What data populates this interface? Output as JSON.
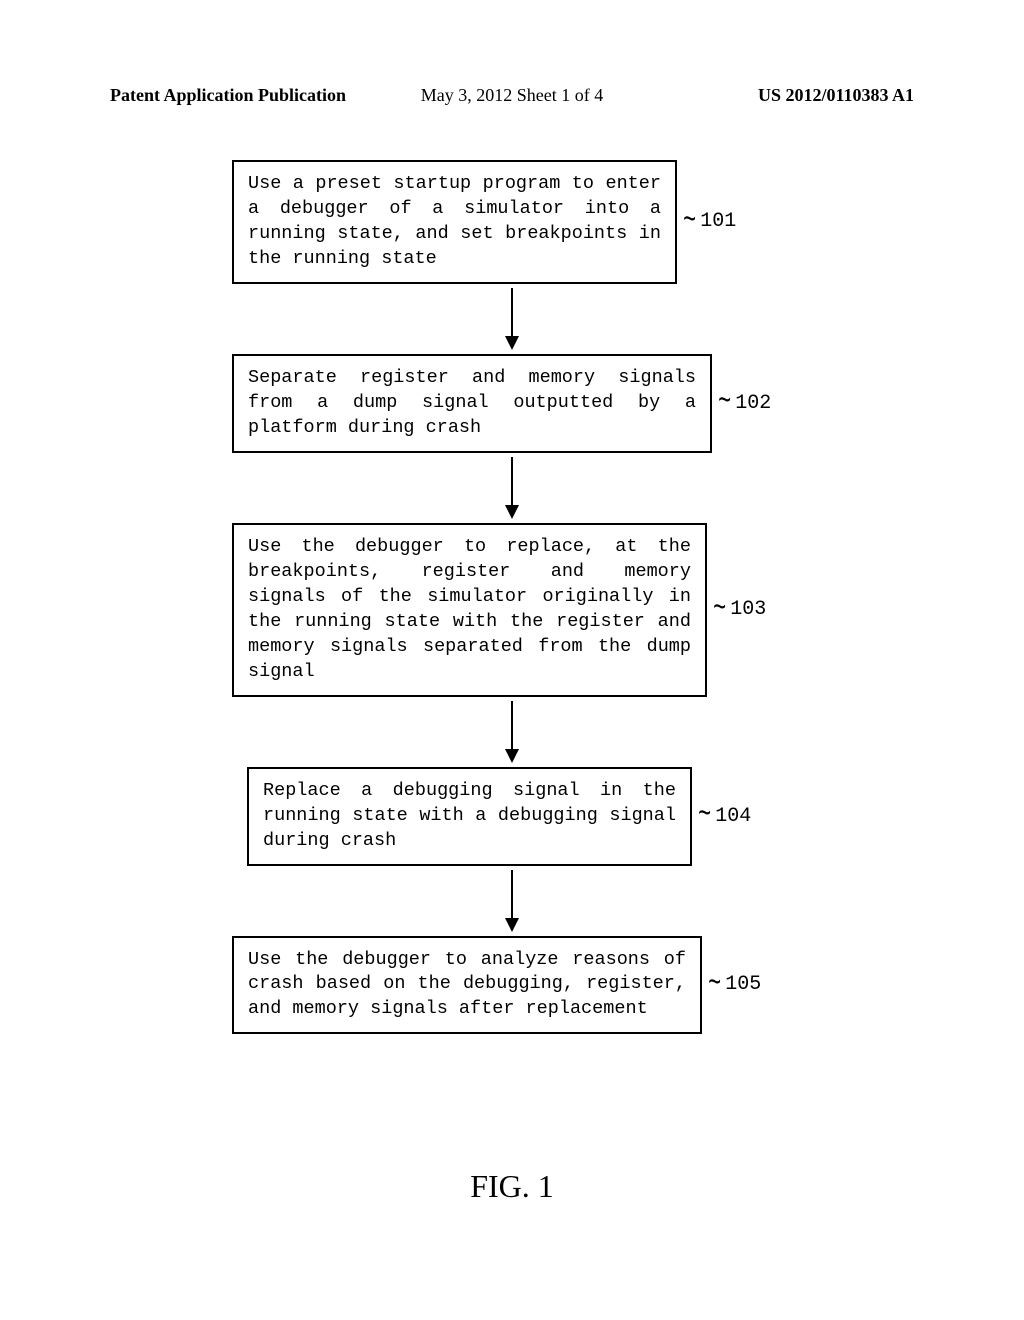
{
  "header": {
    "left": "Patent Application Publication",
    "center": "May 3, 2012   Sheet 1 of 4",
    "right": "US 2012/0110383 A1"
  },
  "steps": [
    {
      "text": "Use a preset startup program to enter a debugger of a simulator into a running state, and set breakpoints in the running state",
      "label": "101"
    },
    {
      "text": "Separate register and memory signals from a dump signal outputted by a platform during crash",
      "label": "102"
    },
    {
      "text": "Use the debugger to replace, at the breakpoints, register and memory signals of the simulator originally in the running state with the register and memory signals separated from the dump signal",
      "label": "103"
    },
    {
      "text": "Replace a debugging signal in the running state with a debugging signal during crash",
      "label": "104"
    },
    {
      "text": "Use the debugger to analyze reasons of crash based on the debugging, register, and memory signals after replacement",
      "label": "105"
    }
  ],
  "figure_label": "FIG. 1"
}
